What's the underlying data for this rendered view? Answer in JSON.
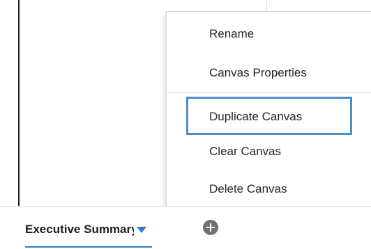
{
  "context_menu": {
    "items": [
      {
        "label": "Rename"
      },
      {
        "label": "Canvas Properties"
      },
      {
        "label": "Duplicate Canvas",
        "focused": true
      },
      {
        "label": "Clear Canvas"
      },
      {
        "label": "Delete Canvas"
      }
    ]
  },
  "tabs": {
    "active_label": "Executive Summary",
    "caret_icon": "chevron-down-icon",
    "add_icon": "plus-circle-icon"
  },
  "colors": {
    "accent": "#2f7ec6",
    "focus_ring": "#4c8cc9",
    "add_button": "#707070"
  }
}
